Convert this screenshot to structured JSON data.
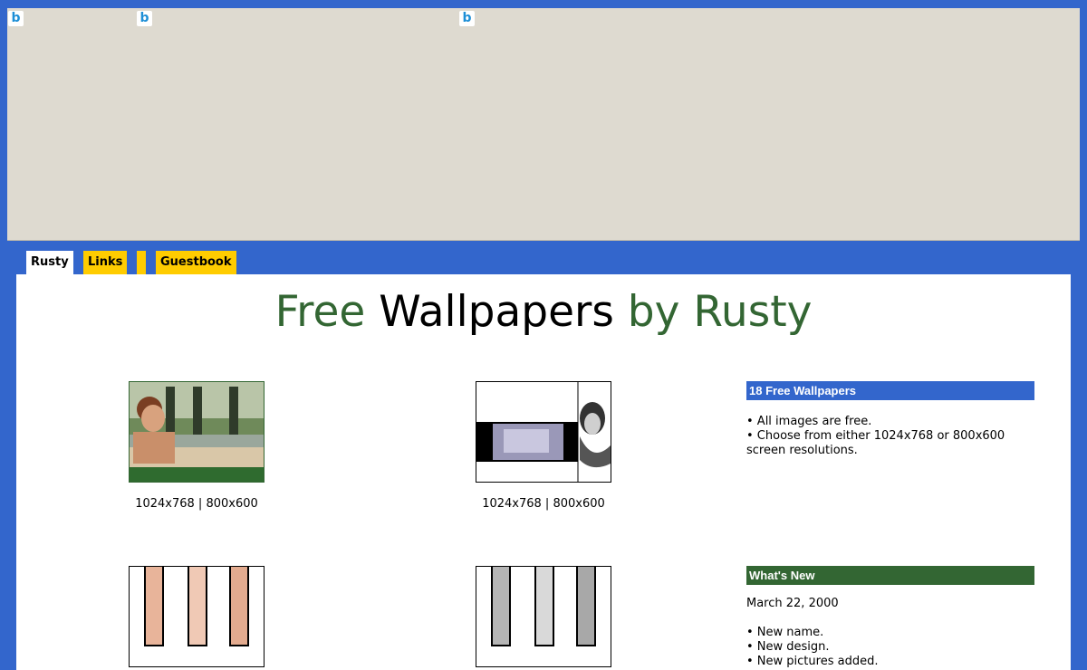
{
  "ad": {
    "badge_glyph": "b"
  },
  "nav": {
    "tabs": [
      {
        "label": "Rusty"
      },
      {
        "label": "Links"
      },
      {
        "label": "Guestbook"
      }
    ]
  },
  "title": {
    "part1": "Free ",
    "part2": "Wallpapers",
    "part3": " by Rusty"
  },
  "wallpapers": {
    "items": [
      {
        "res1": "1024x768",
        "sep": " | ",
        "res2": "800x600"
      },
      {
        "res1": "1024x768",
        "sep": " | ",
        "res2": "800x600"
      }
    ]
  },
  "sidebar": {
    "free_box": {
      "heading": "18 Free Wallpapers",
      "line1": "• All images are free.",
      "line2": "• Choose from either 1024x768 or 800x600 screen resolutions."
    },
    "news_box": {
      "heading": "What's New",
      "date": "March 22, 2000",
      "items": [
        "• New name.",
        "• New design.",
        "• New pictures added."
      ]
    }
  },
  "colors": {
    "page_bg": "#3366cc",
    "title_green": "#336633",
    "tab_yellow": "#ffcc00",
    "ad_bg": "#dedad0"
  }
}
